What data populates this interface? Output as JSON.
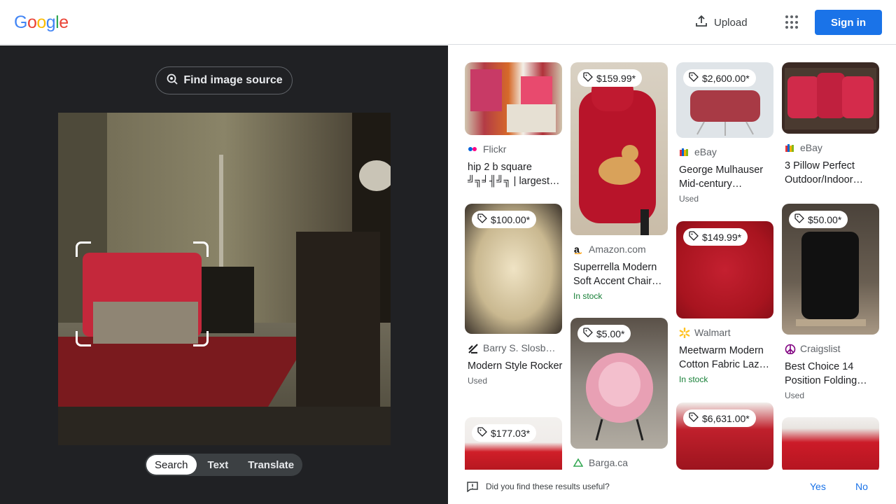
{
  "header": {
    "logo_letters": [
      "G",
      "o",
      "o",
      "g",
      "l",
      "e"
    ],
    "logo_colors": [
      "#4285f4",
      "#ea4335",
      "#fbbc05",
      "#4285f4",
      "#34a853",
      "#ea4335"
    ],
    "upload_label": "Upload",
    "signin_label": "Sign in"
  },
  "lens": {
    "find_source_label": "Find image source",
    "modes": [
      "Search",
      "Text",
      "Translate"
    ],
    "active_mode": "Search"
  },
  "results": [
    {
      "source": "Flickr",
      "title": "hip 2 b square ╝╗╛╢╝╗ | largest…",
      "price": "",
      "meta": ""
    },
    {
      "source": "Amazon.com",
      "title": "Superrella Modern Soft Accent Chair…",
      "price": "$159.99*",
      "meta": "In stock"
    },
    {
      "source": "eBay",
      "title": "George Mulhauser Mid-century…",
      "price": "$2,600.00*",
      "meta": "Used"
    },
    {
      "source": "eBay",
      "title": "3 Pillow Perfect Outdoor/Indoor…",
      "price": "",
      "meta": ""
    },
    {
      "source": "Barry S. Slosb…",
      "title": "Modern Style Rocker",
      "price": "$100.00*",
      "meta": "Used"
    },
    {
      "source": "Walmart",
      "title": "Meetwarm Modern Cotton Fabric Laz…",
      "price": "$149.99*",
      "meta": "In stock"
    },
    {
      "source": "Craigslist",
      "title": "Best Choice 14 Position Folding…",
      "price": "$50.00*",
      "meta": "Used"
    },
    {
      "source": "Barga.ca",
      "title": "",
      "price": "$5.00*",
      "meta": ""
    },
    {
      "source": "",
      "title": "",
      "price": "$177.03*",
      "meta": ""
    },
    {
      "source": "",
      "title": "",
      "price": "$6,631.00*",
      "meta": ""
    }
  ],
  "feedback": {
    "question": "Did you find these results useful?",
    "yes": "Yes",
    "no": "No"
  }
}
